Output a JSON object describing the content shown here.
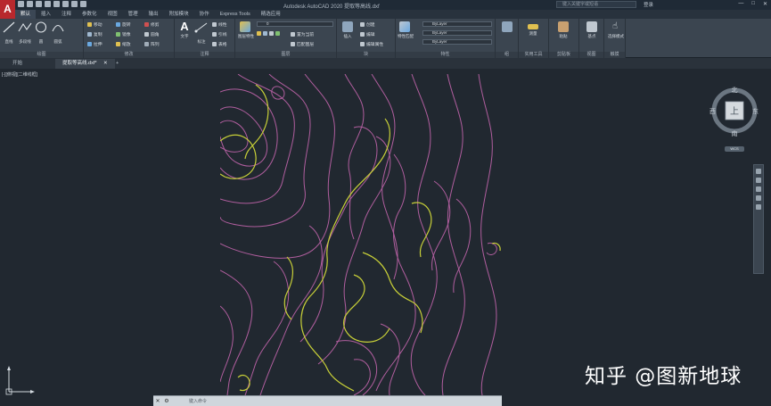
{
  "app": {
    "logo_letter": "A",
    "title": "Autodesk AutoCAD 2020    提取等高线.dxf",
    "search_placeholder": "键入关键字或短语",
    "user": "登录",
    "window_controls": [
      "—",
      "□",
      "✕"
    ]
  },
  "ribbon_tabs": [
    "默认",
    "插入",
    "注释",
    "参数化",
    "视图",
    "管理",
    "输出",
    "附加模块",
    "协作",
    "Express Tools",
    "精选应用"
  ],
  "ribbon": {
    "draw": {
      "label": "绘图",
      "tools": [
        "直线",
        "多段线",
        "圆",
        "圆弧"
      ]
    },
    "modify": {
      "label": "修改",
      "rows": [
        [
          "移动",
          "旋转",
          "修剪"
        ],
        [
          "复制",
          "镜像",
          "圆角"
        ],
        [
          "拉伸",
          "缩放",
          "阵列"
        ]
      ]
    },
    "annotation": {
      "label": "注释",
      "tools": [
        "文字",
        "标注"
      ],
      "rows": [
        "线性",
        "引线",
        "表格"
      ]
    },
    "layers": {
      "label": "图层",
      "tools": [
        "图层特性"
      ],
      "current_layer": "0",
      "rows": [
        "置为当前",
        "匹配图层"
      ]
    },
    "block": {
      "label": "块",
      "tools": [
        "插入"
      ],
      "rows": [
        "创建",
        "编辑",
        "编辑属性"
      ]
    },
    "properties": {
      "label": "特性",
      "tools": [
        "特性匹配"
      ],
      "color": "ByLayer",
      "linetype": "ByLayer",
      "lineweight": "ByLayer"
    },
    "groups": {
      "label": "组"
    },
    "utilities": {
      "label": "实用工具",
      "tools": [
        "测量"
      ]
    },
    "clipboard": {
      "label": "剪贴板",
      "tools": [
        "粘贴"
      ]
    },
    "view": {
      "label": "视图",
      "tools": [
        "基点"
      ]
    },
    "touch": {
      "label": "触摸",
      "tools": [
        "选择模式"
      ]
    }
  },
  "doc_tabs": [
    "开始",
    "提取等高线.dxf*"
  ],
  "viewport_label": "[-][俯视][二维线框]",
  "viewcube": {
    "top": "上",
    "north": "北",
    "south": "南",
    "east": "东",
    "west": "西",
    "wcs": "WCS"
  },
  "command_placeholder": "键入命令",
  "watermark": "知乎 @图新地球",
  "colors": {
    "index_contour": "#c8d038",
    "contour": "#b05e9e",
    "background": "#212830"
  }
}
